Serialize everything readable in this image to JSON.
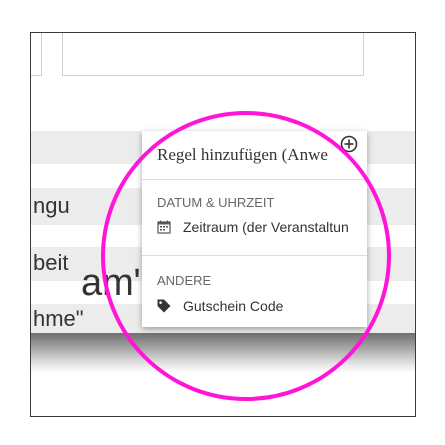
{
  "background_rows": {
    "row1_text": "ngu",
    "row2_text": "beit",
    "row2_big_text": "am\"",
    "row3_text": "hme\""
  },
  "popup": {
    "title": "Regel hinzufügen (Anwe",
    "sections": [
      {
        "header": "DATUM & UHRZEIT",
        "items": [
          {
            "label": "Zeitraum (der Veranstaltun",
            "icon": "calendar-icon"
          }
        ]
      },
      {
        "header": "ANDERE",
        "items": [
          {
            "label": "Gutschein Code",
            "icon": "tag-icon"
          }
        ]
      }
    ]
  },
  "colors": {
    "highlight_ring": "#ff14d8",
    "trash_icon": "#f26b1d",
    "row_background": "#ececec"
  }
}
